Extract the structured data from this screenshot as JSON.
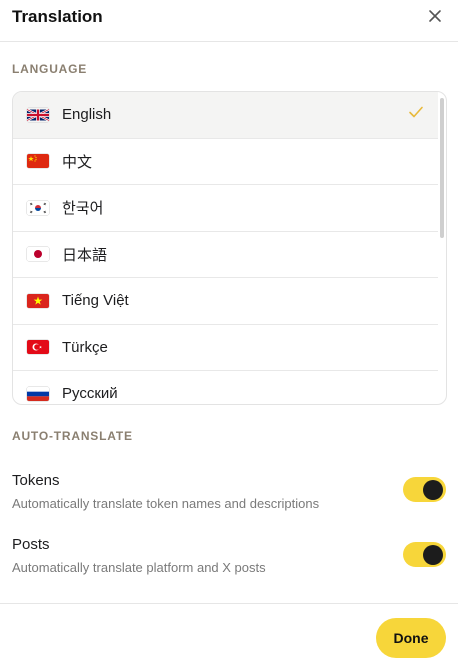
{
  "dialog": {
    "title": "Translation"
  },
  "language": {
    "section_label": "LANGUAGE",
    "selected": "English",
    "items": [
      {
        "label": "English",
        "flag": "uk-flag"
      },
      {
        "label": "中文",
        "flag": "china-flag"
      },
      {
        "label": "한국어",
        "flag": "korea-flag"
      },
      {
        "label": "日本語",
        "flag": "japan-flag"
      },
      {
        "label": "Tiếng Việt",
        "flag": "vietnam-flag"
      },
      {
        "label": "Türkçe",
        "flag": "turkey-flag"
      },
      {
        "label": "Русский",
        "flag": "russia-flag"
      }
    ]
  },
  "auto_translate": {
    "section_label": "AUTO-TRANSLATE",
    "tokens": {
      "title": "Tokens",
      "description": "Automatically translate token names and descriptions",
      "enabled": true
    },
    "posts": {
      "title": "Posts",
      "description": "Automatically translate platform and X posts",
      "enabled": true
    }
  },
  "footer": {
    "done_label": "Done"
  },
  "colors": {
    "accent": "#f7d63a",
    "check": "#e8b93a",
    "section_label": "#8a7f70"
  }
}
